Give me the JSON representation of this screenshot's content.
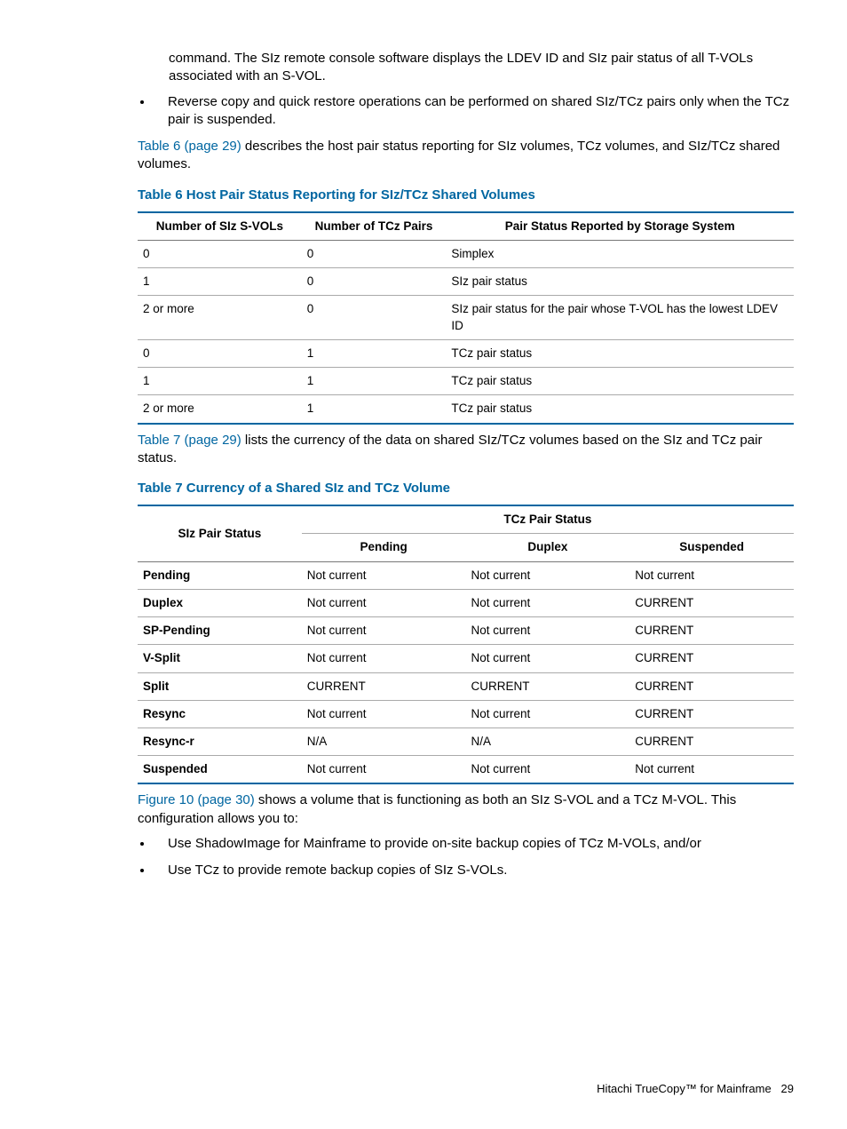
{
  "intro": {
    "continuation": "command. The SIz remote console software displays the LDEV ID and SIz pair status of all T-VOLs associated with an S-VOL.",
    "bullet1": "Reverse copy and quick restore operations can be performed on shared SIz/TCz pairs only when the TCz pair is suspended.",
    "para2_link": "Table 6 (page 29)",
    "para2_rest": " describes the host pair status reporting for SIz volumes, TCz volumes, and SIz/TCz shared volumes."
  },
  "table6": {
    "caption": "Table 6 Host Pair Status Reporting for SIz/TCz Shared Volumes",
    "headers": [
      "Number of SIz S-VOLs",
      "Number of TCz Pairs",
      "Pair Status Reported by Storage System"
    ],
    "rows": [
      [
        "0",
        "0",
        "Simplex"
      ],
      [
        "1",
        "0",
        "SIz pair status"
      ],
      [
        "2 or more",
        "0",
        "SIz pair status for the pair whose T-VOL has the lowest LDEV ID"
      ],
      [
        "0",
        "1",
        "TCz pair status"
      ],
      [
        "1",
        "1",
        "TCz pair status"
      ],
      [
        "2 or more",
        "1",
        "TCz pair status"
      ]
    ]
  },
  "mid": {
    "link": "Table 7 (page 29)",
    "rest": " lists the currency of the data on shared SIz/TCz volumes based on the SIz and TCz pair status."
  },
  "table7": {
    "caption": "Table 7 Currency of a Shared SIz and TCz Volume",
    "header_siz": "SIz Pair Status",
    "header_tcz": "TCz Pair Status",
    "subheaders": [
      "Pending",
      "Duplex",
      "Suspended"
    ],
    "rows": [
      {
        "label": "Pending",
        "cells": [
          "Not current",
          "Not current",
          "Not current"
        ]
      },
      {
        "label": "Duplex",
        "cells": [
          "Not current",
          "Not current",
          "CURRENT"
        ]
      },
      {
        "label": "SP-Pending",
        "cells": [
          "Not current",
          "Not current",
          "CURRENT"
        ]
      },
      {
        "label": "V-Split",
        "cells": [
          "Not current",
          "Not current",
          "CURRENT"
        ]
      },
      {
        "label": "Split",
        "cells": [
          "CURRENT",
          "CURRENT",
          "CURRENT"
        ]
      },
      {
        "label": "Resync",
        "cells": [
          "Not current",
          "Not current",
          "CURRENT"
        ]
      },
      {
        "label": "Resync-r",
        "cells": [
          "N/A",
          "N/A",
          "CURRENT"
        ]
      },
      {
        "label": "Suspended",
        "cells": [
          "Not current",
          "Not current",
          "Not current"
        ]
      }
    ]
  },
  "outro": {
    "link": "Figure 10 (page 30)",
    "rest": " shows a volume that is functioning as both an SIz S-VOL and a TCz M-VOL. This configuration allows you to:",
    "bullet1": "Use ShadowImage for Mainframe to provide on-site backup copies of TCz M-VOLs, and/or",
    "bullet2": "Use TCz to provide remote backup copies of SIz S-VOLs."
  },
  "footer": {
    "title": "Hitachi TrueCopy™ for Mainframe",
    "page": "29"
  }
}
